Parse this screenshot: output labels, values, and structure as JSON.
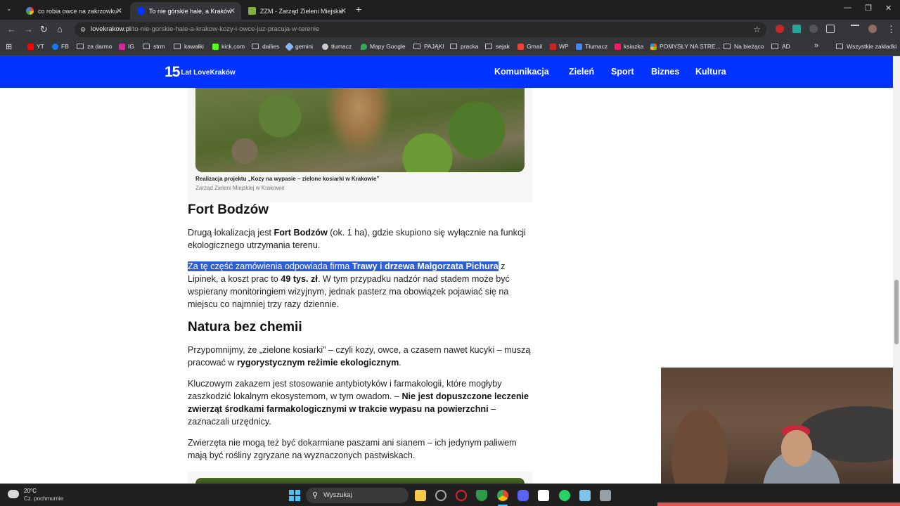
{
  "browser": {
    "tabs": [
      {
        "title": "co robia owce na zakrzowku - S",
        "active": false
      },
      {
        "title": "To nie górskie hale, a Kraków! K",
        "active": true
      },
      {
        "title": "ZZM - Zarząd Zieleni Miejskiej w",
        "active": false
      }
    ],
    "url_host": "lovekrakow.pl",
    "url_path": "/to-nie-gorskie-hale-a-krakow-kozy-i-owce-juz-pracuja-w-terenie",
    "bookmarks": [
      "YT",
      "FB",
      "za darmo",
      "IG",
      "strm",
      "kawałki",
      "kick.com",
      "dailies",
      "gemini",
      "tłumacz",
      "Mapy Google",
      "PAJĄKI",
      "pracka",
      "sejak",
      "Gmail",
      "WP",
      "Tłumacz",
      "ksiazka",
      "POMYSŁY NA STRE...",
      "Na bieżąco",
      "AD"
    ],
    "all_bookmarks": "Wszystkie zakładki"
  },
  "site": {
    "logo_number": "15",
    "logo_text": "Lat LoveKraków",
    "menu": [
      "Komunikacja",
      "Zieleń",
      "Sport",
      "Biznes",
      "Kultura"
    ]
  },
  "article": {
    "caption_title": "Realizacja projektu „Kozy na wypasie – zielone kosiarki w Krakowie”",
    "caption_source": "Zarząd Zieleni Miejskiej w Krakowie",
    "h_fort": "Fort Bodzów",
    "p1_a": "Drugą lokalizacją jest ",
    "p1_b": "Fort Bodzów",
    "p1_c": " (ok. 1 ha), gdzie skupiono się wyłącznie na funkcji ekologicznego utrzymania terenu.",
    "p2_sel": "Za tę część zamówienia odpowiada firma ",
    "p2_sel_b": "Trawy i drzewa Małgorzata Pichura",
    "p2_a": " z Lipinek, a koszt prac to ",
    "p2_b": "49 tys. zł",
    "p2_c": ". W tym przypadku nadzór nad stadem może być wspierany monitoringiem wizyjnym, jednak pasterz ma obowiązek pojawiać się na miejscu co najmniej trzy razy dziennie.",
    "h_natura": "Natura bez chemii",
    "p3_a": "Przypomnijmy, że „zielone kosiarki” – czyli kozy, owce, a czasem nawet kucyki – muszą pracować w ",
    "p3_b": "rygorystycznym reżimie ekologicznym",
    "p3_c": ".",
    "p4_a": "Kluczowym zakazem jest stosowanie antybiotyków i farmakologii, które mogłyby zaszkodzić lokalnym ekosystemom, w tym owadom. – ",
    "p4_b": "Nie jest dopuszczone leczenie zwierząt środkami farmakologicznymi w trakcie wypasu na powierzchni",
    "p4_c": " – zaznaczali urzędnicy.",
    "p5": "Zwierzęta nie mogą też być dokarmiane paszami ani sianem – ich jedynym paliwem mają być rośliny zgryzane na wyznaczonych pastwiskach."
  },
  "taskbar": {
    "temperature": "20°C",
    "weather": "Cz. pochmurnie",
    "search_placeholder": "Wyszukaj"
  },
  "colors": {
    "site_blue": "#0033ff",
    "selection": "#2c5fd7",
    "taskbar": "#202020"
  }
}
